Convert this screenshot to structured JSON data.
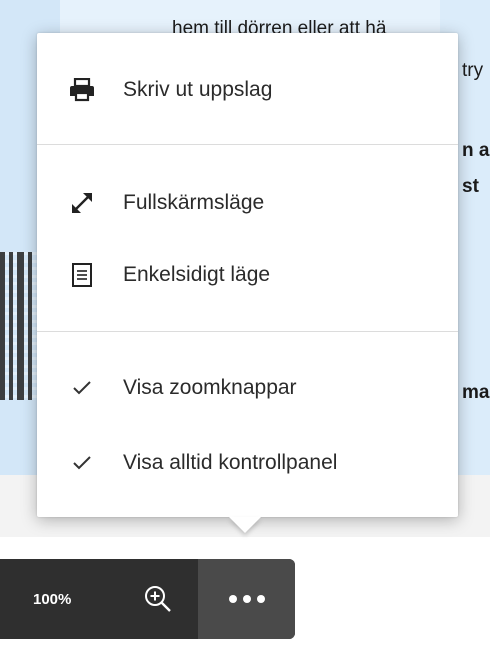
{
  "background": {
    "text_fragments": [
      "hem till dörren eller att hä",
      "try",
      "n a",
      "st",
      "ma"
    ]
  },
  "menu": {
    "items": [
      {
        "label": "Skriv ut uppslag",
        "icon": "print-icon"
      },
      {
        "label": "Fullskärmsläge",
        "icon": "expand-icon"
      },
      {
        "label": "Enkelsidigt läge",
        "icon": "single-page-icon"
      },
      {
        "label": "Visa zoomknappar",
        "icon": "checkmark-icon",
        "checked": true
      },
      {
        "label": "Visa alltid kontrollpanel",
        "icon": "checkmark-icon",
        "checked": true
      }
    ]
  },
  "toolbar": {
    "zoom_level": "100%",
    "zoom_in_icon": "zoom-in-icon",
    "more_icon": "more-options-icon"
  },
  "colors": {
    "page_background": "#e6f2fc",
    "toolbar": "#2f2f2f",
    "toolbar_active": "#4a4a4a",
    "menu_text": "#2b2b2b"
  }
}
